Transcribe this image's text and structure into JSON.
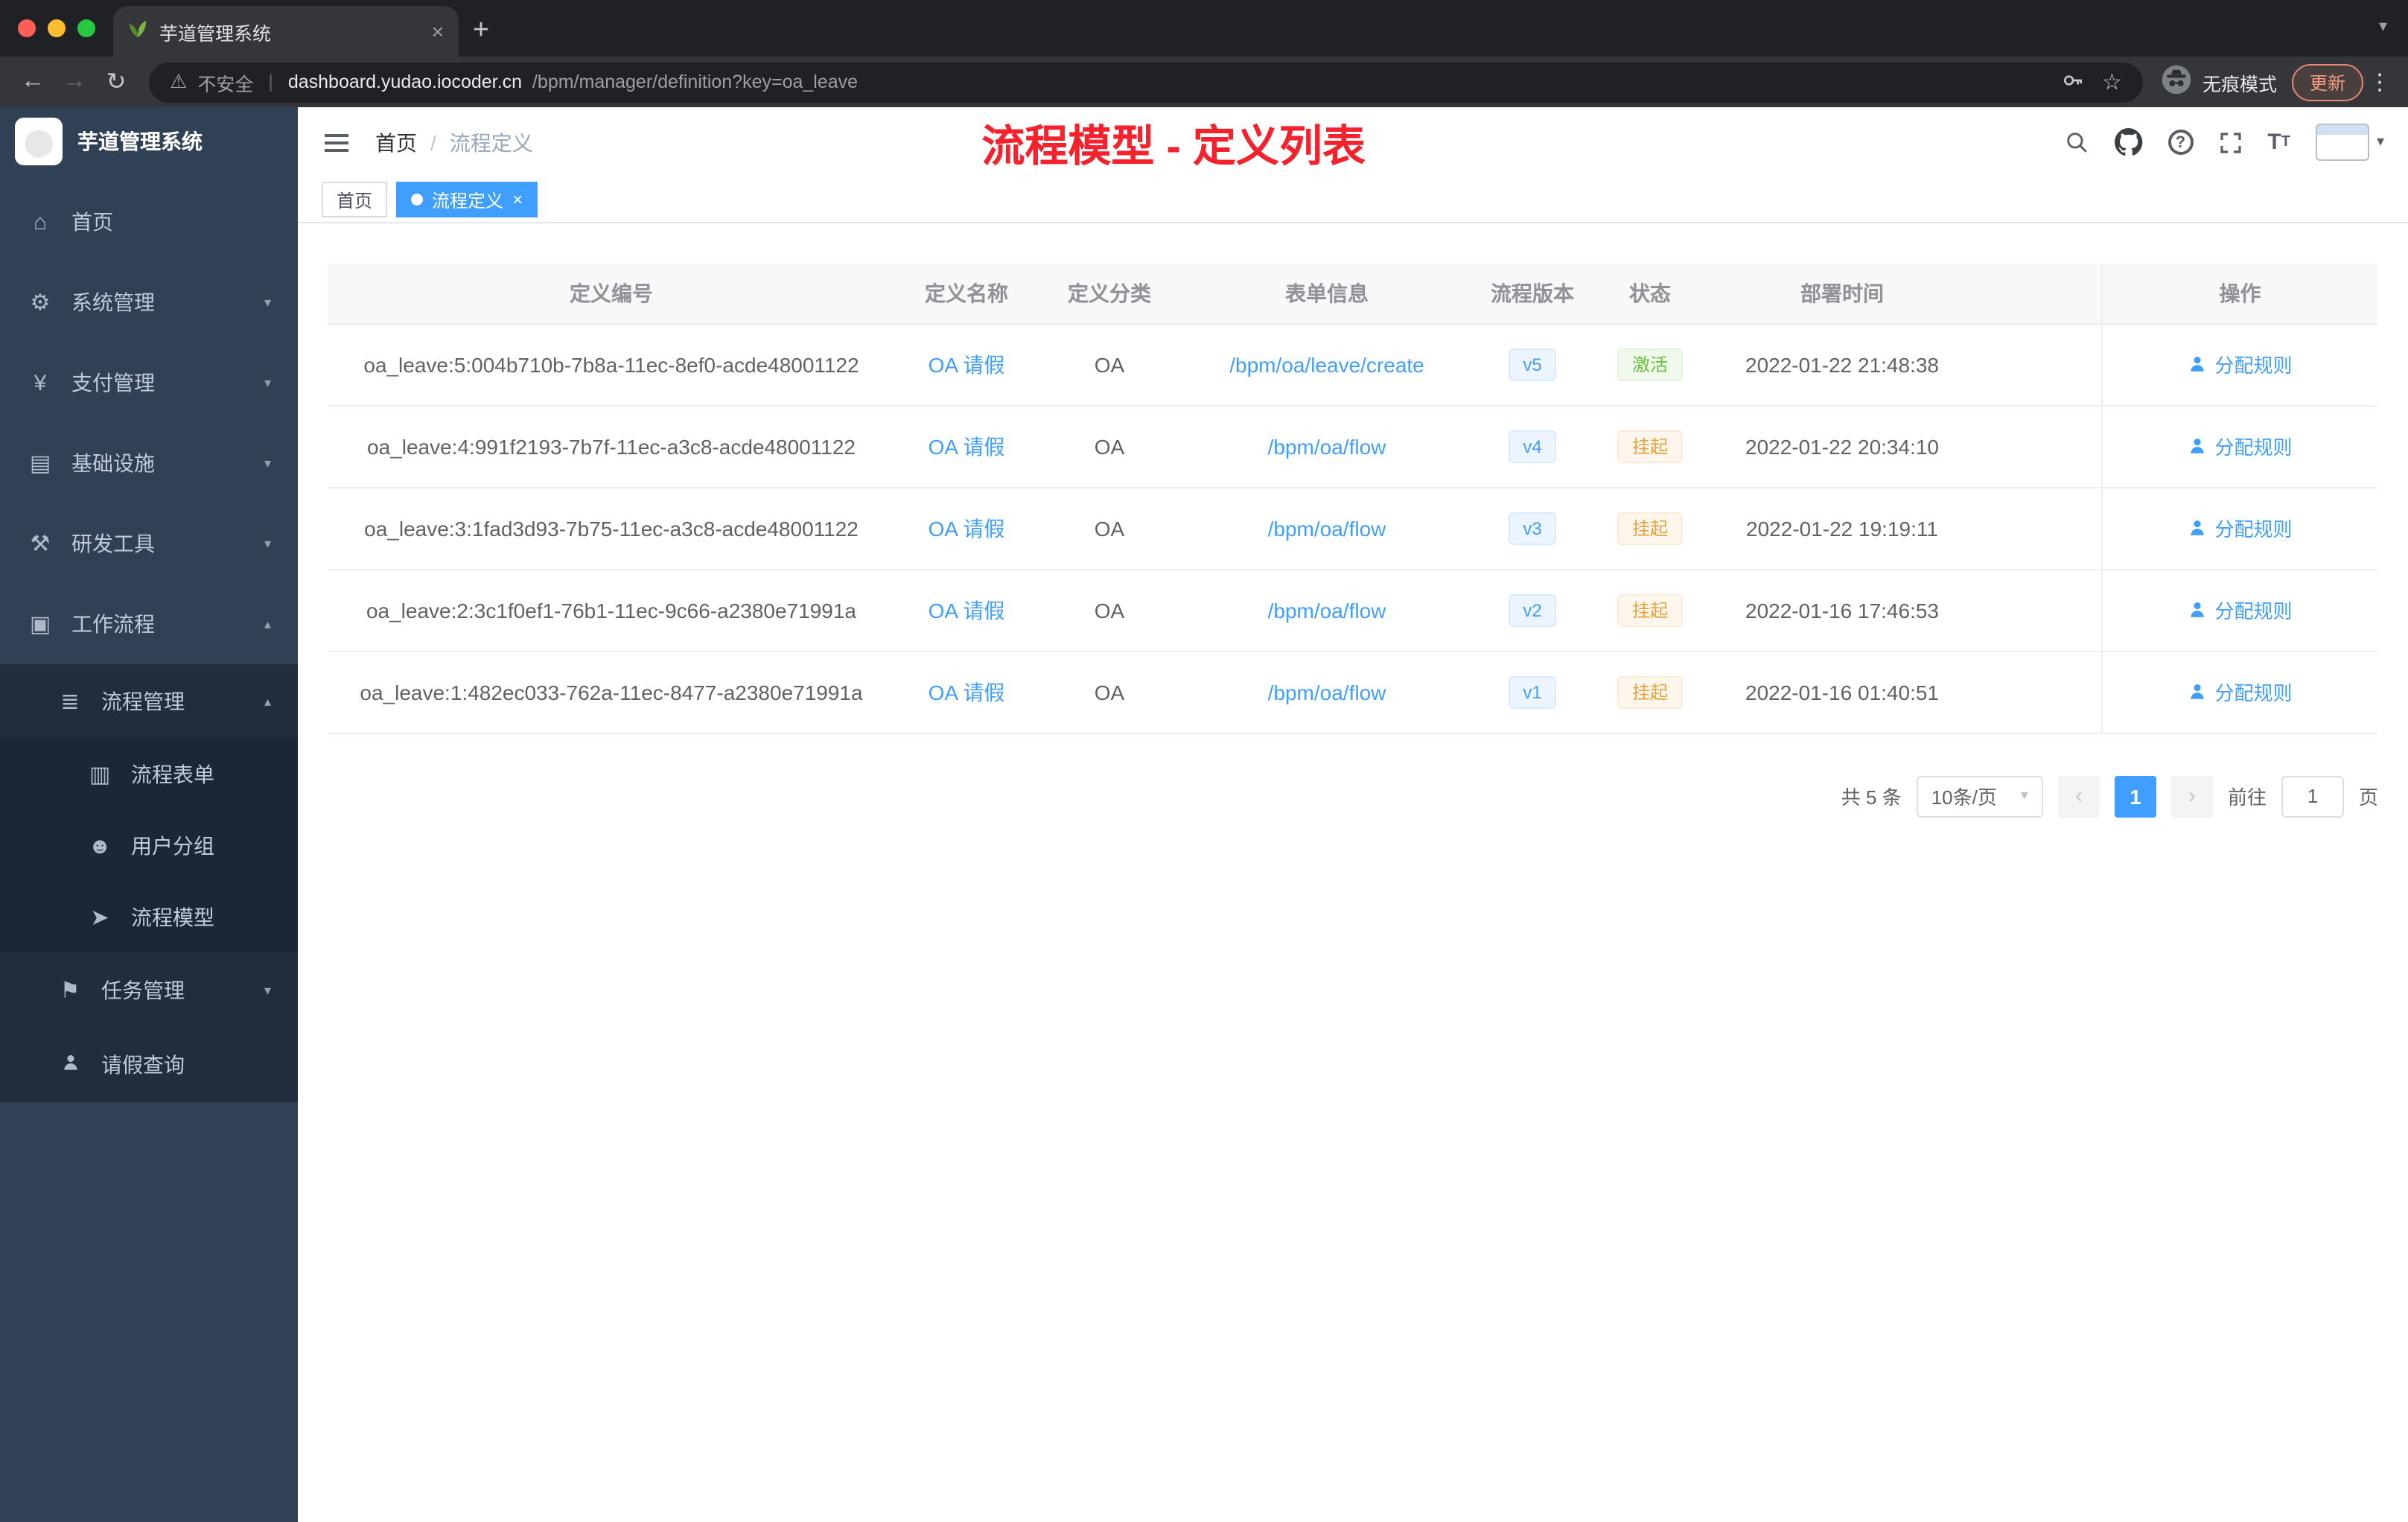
{
  "colors": {
    "accent": "#409eff",
    "annotation_red": "#f5222d",
    "success_green": "#67c23a",
    "warning_orange": "#e6a23c",
    "sidebar_bg": "#304156",
    "submenu_bg": "#1f2d3d"
  },
  "browser": {
    "tab_title": "芋道管理系统",
    "security_label": "不安全",
    "url_domain": "dashboard.yudao.iocoder.cn",
    "url_path": "/bpm/manager/definition?key=oa_leave",
    "incognito_label": "无痕模式",
    "update_label": "更新"
  },
  "sidebar": {
    "app_title": "芋道管理系统",
    "items": {
      "home": "首页",
      "system": "系统管理",
      "payment": "支付管理",
      "infra": "基础设施",
      "devtools": "研发工具",
      "workflow": "工作流程",
      "process_mgmt": "流程管理",
      "process_form": "流程表单",
      "user_group": "用户分组",
      "process_model": "流程模型",
      "task_mgmt": "任务管理",
      "leave_query": "请假查询"
    }
  },
  "header": {
    "breadcrumb_home": "首页",
    "breadcrumb_sep": "/",
    "breadcrumb_current": "流程定义",
    "annotation": "流程模型 - 定义列表"
  },
  "tags": {
    "home": "首页",
    "active": "流程定义"
  },
  "table": {
    "columns": {
      "id": "定义编号",
      "name": "定义名称",
      "category": "定义分类",
      "form": "表单信息",
      "version": "流程版本",
      "status": "状态",
      "deploy_time": "部署时间",
      "action": "操作"
    },
    "rows": [
      {
        "id": "oa_leave:5:004b710b-7b8a-11ec-8ef0-acde48001122",
        "name": "OA 请假",
        "category": "OA",
        "form": "/bpm/oa/leave/create",
        "version": "v5",
        "status": "激活",
        "status_type": "success",
        "deploy_time": "2022-01-22 21:48:38",
        "action": "分配规则"
      },
      {
        "id": "oa_leave:4:991f2193-7b7f-11ec-a3c8-acde48001122",
        "name": "OA 请假",
        "category": "OA",
        "form": "/bpm/oa/flow",
        "version": "v4",
        "status": "挂起",
        "status_type": "warning",
        "deploy_time": "2022-01-22 20:34:10",
        "action": "分配规则"
      },
      {
        "id": "oa_leave:3:1fad3d93-7b75-11ec-a3c8-acde48001122",
        "name": "OA 请假",
        "category": "OA",
        "form": "/bpm/oa/flow",
        "version": "v3",
        "status": "挂起",
        "status_type": "warning",
        "deploy_time": "2022-01-22 19:19:11",
        "action": "分配规则"
      },
      {
        "id": "oa_leave:2:3c1f0ef1-76b1-11ec-9c66-a2380e71991a",
        "name": "OA 请假",
        "category": "OA",
        "form": "/bpm/oa/flow",
        "version": "v2",
        "status": "挂起",
        "status_type": "warning",
        "deploy_time": "2022-01-16 17:46:53",
        "action": "分配规则"
      },
      {
        "id": "oa_leave:1:482ec033-762a-11ec-8477-a2380e71991a",
        "name": "OA 请假",
        "category": "OA",
        "form": "/bpm/oa/flow",
        "version": "v1",
        "status": "挂起",
        "status_type": "warning",
        "deploy_time": "2022-01-16 01:40:51",
        "action": "分配规则"
      }
    ]
  },
  "pagination": {
    "total": "共 5 条",
    "page_size": "10条/页",
    "current_page": "1",
    "goto_label": "前往",
    "goto_value": "1",
    "page_unit": "页"
  }
}
